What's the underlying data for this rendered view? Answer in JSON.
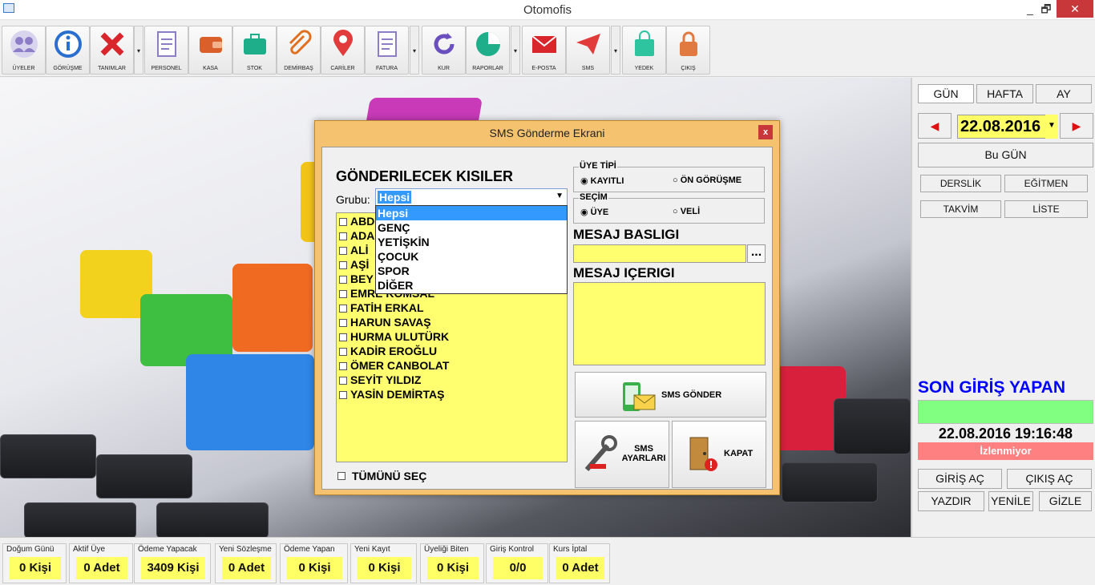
{
  "window": {
    "title": "Otomofis",
    "minimize": "_",
    "maximize": "🗗",
    "close": "✕"
  },
  "toolbar": [
    {
      "label": "ÜYELER",
      "icon": "users-icon"
    },
    {
      "label": "GÖRÜŞME",
      "icon": "info-icon"
    },
    {
      "label": "TANIMLAR",
      "icon": "tools-icon"
    },
    {
      "label": "PERSONEL",
      "icon": "document-icon"
    },
    {
      "label": "KASA",
      "icon": "wallet-icon"
    },
    {
      "label": "STOK",
      "icon": "briefcase-icon"
    },
    {
      "label": "DEMİRBAŞ",
      "icon": "paperclip-icon"
    },
    {
      "label": "CARİLER",
      "icon": "map-pin-icon"
    },
    {
      "label": "FATURA",
      "icon": "invoice-icon"
    },
    {
      "label": "KUR",
      "icon": "refresh-icon"
    },
    {
      "label": "RAPORLAR",
      "icon": "pie-chart-icon"
    },
    {
      "label": "E-POSTA",
      "icon": "envelope-icon"
    },
    {
      "label": "SMS",
      "icon": "send-icon"
    },
    {
      "label": "YEDEK",
      "icon": "shopping-bag-icon"
    },
    {
      "label": "ÇIKIŞ",
      "icon": "lock-icon"
    }
  ],
  "dialog": {
    "title": "SMS Gönderme Ekrani",
    "close": "x",
    "recipients_heading": "GÖNDERILECEK KISILER",
    "group_label": "Grubu:",
    "group_selected": "Hepsi",
    "group_options": [
      "Hepsi",
      "GENÇ",
      "YETİŞKİN",
      "ÇOCUK",
      "SPOR",
      "DİĞER"
    ],
    "contacts": [
      "ABD",
      "ADA",
      "ALİ",
      "AŞİ",
      "BEY",
      "EMRE KOMSAL",
      "FATİH ERKAL",
      "HARUN SAVAŞ",
      "HURMA ULUTÜRK",
      "KADİR EROĞLU",
      "ÖMER CANBOLAT",
      "SEYİT YILDIZ",
      "YASİN DEMİRTAŞ"
    ],
    "select_all": "TÜMÜNÜ SEÇ",
    "member_type": {
      "legend": "ÜYE TİPİ",
      "options": [
        "KAYITLI",
        "ÖN GÖRÜŞME"
      ],
      "selected": "KAYITLI"
    },
    "selection": {
      "legend": "SEÇİM",
      "options": [
        "ÜYE",
        "VELİ"
      ],
      "selected": "ÜYE"
    },
    "message_title_label": "MESAJ BASLIGI",
    "message_title_value": "",
    "browse": "...",
    "message_body_label": "MESAJ IÇERIGI",
    "message_body_value": "",
    "send_button": "SMS GÖNDER",
    "settings_button": "SMS AYARLARI",
    "close_button": "KAPAT"
  },
  "right": {
    "tabs": [
      "GÜN",
      "HAFTA",
      "AY"
    ],
    "date": "22.08.2016",
    "today": "Bu GÜN",
    "buttons_row1": [
      "DERSLİK",
      "EĞİTMEN"
    ],
    "buttons_row2": [
      "TAKVİM",
      "LİSTE"
    ],
    "last_login_title": "SON GİRİŞ YAPAN",
    "last_login_time": "22.08.2016 19:16:48",
    "status": "İzlenmiyor",
    "actions_row1": [
      "GİRİŞ AÇ",
      "ÇIKIŞ AÇ"
    ],
    "actions_row2": [
      "YAZDIR",
      "YENİLE",
      "GİZLE"
    ]
  },
  "stats": [
    {
      "caption": "Doğum Günü",
      "value": "0 Kişi"
    },
    {
      "caption": "Aktif Üye",
      "value": "0 Adet"
    },
    {
      "caption": "Ödeme Yapacak",
      "value": "3409 Kişi"
    },
    {
      "caption": "Yeni Sözleşme",
      "value": "0 Adet"
    },
    {
      "caption": "Ödeme Yapan",
      "value": "0 Kişi"
    },
    {
      "caption": "Yeni Kayıt",
      "value": "0 Kişi"
    },
    {
      "caption": "Üyeliği Biten",
      "value": "0 Kişi"
    },
    {
      "caption": "Giriş Kontrol",
      "value": "0/0"
    },
    {
      "caption": "Kurs İptal",
      "value": "0 Adet"
    }
  ],
  "colors": {
    "accent_yellow": "#ffff66",
    "dialog_frame": "#f5c370",
    "login_green": "#80ff80",
    "status_red": "#ff8080",
    "heading_blue": "#0000ff"
  }
}
